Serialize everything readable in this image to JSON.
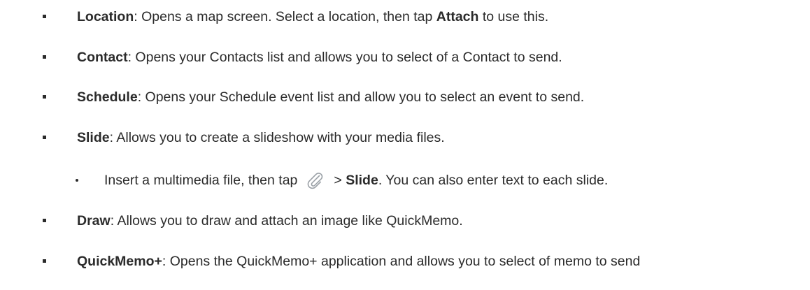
{
  "items": [
    {
      "term": "Location",
      "pre": ": Opens a map screen. Select a location, then tap ",
      "bold2": "Attach",
      "post": " to use this."
    },
    {
      "term": "Contact",
      "rest": ": Opens your Contacts list and allows you to select of a Contact to send."
    },
    {
      "term": "Schedule",
      "rest": ": Opens your Schedule event list and allow you to select an event to send."
    },
    {
      "term": "Slide",
      "rest": ": Allows you to create a slideshow with your media files."
    },
    {
      "term": "Draw",
      "rest": ": Allows you to draw and attach an image like QuickMemo."
    },
    {
      "term": "QuickMemo+",
      "rest": ": Opens the QuickMemo+ application and allows you to select of memo to send"
    }
  ],
  "sub_item": {
    "pre": "Insert a multimedia file, then tap",
    "icon": "paperclip-icon",
    "gt": "> ",
    "bold": "Slide",
    "post": ". You can also enter text to each slide."
  }
}
